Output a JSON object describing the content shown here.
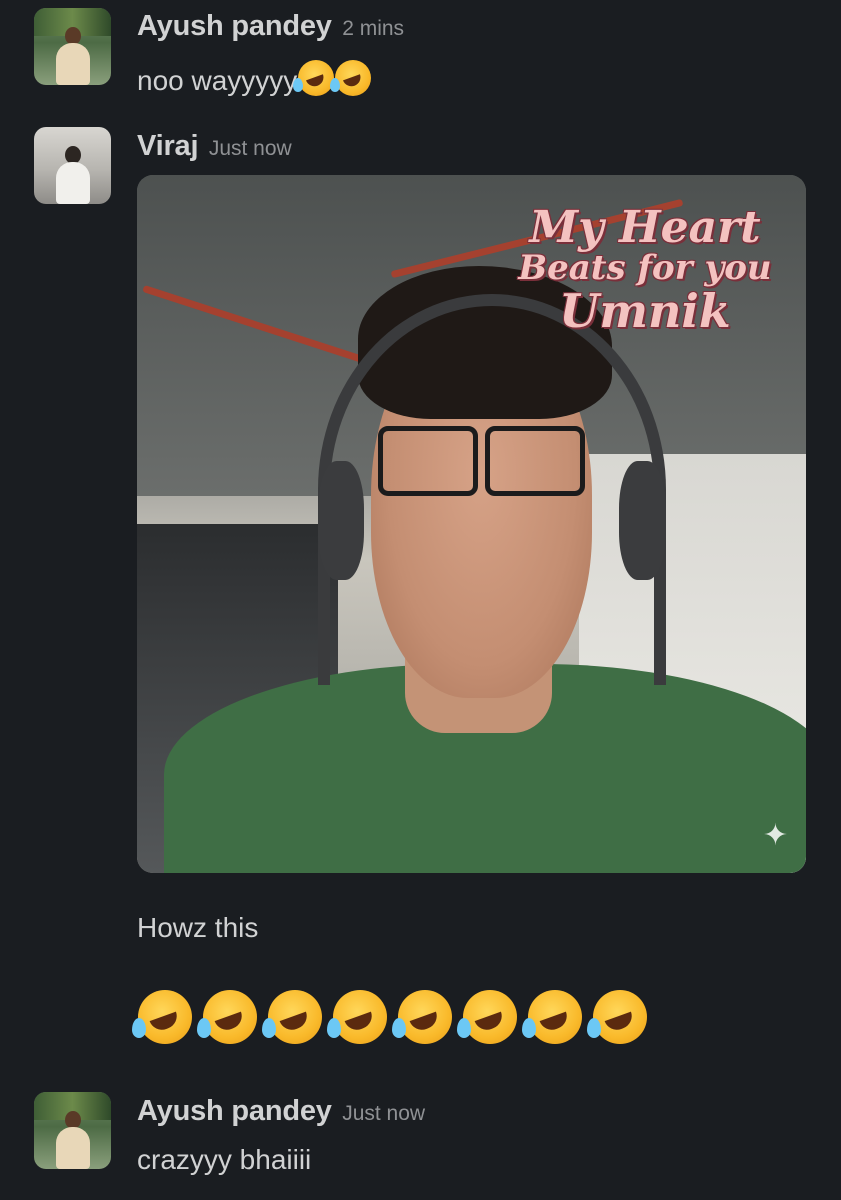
{
  "messages": [
    {
      "author": "Ayush pandey",
      "time": "2 mins",
      "text": "noo wayyyyy",
      "emoji": [
        "rolling-on-floor-laughing",
        "rolling-on-floor-laughing"
      ]
    },
    {
      "author": "Viraj",
      "time": "Just now",
      "image": {
        "sticker_line1": "My Heart",
        "sticker_line2": "Beats for you",
        "sticker_line3": "Umnik"
      },
      "text": "Howz this",
      "big_emoji": [
        "rolling-on-floor-laughing",
        "rolling-on-floor-laughing",
        "rolling-on-floor-laughing",
        "rolling-on-floor-laughing",
        "rolling-on-floor-laughing",
        "rolling-on-floor-laughing",
        "rolling-on-floor-laughing",
        "rolling-on-floor-laughing"
      ]
    },
    {
      "author": "Ayush pandey",
      "time": "Just now",
      "text": "crazyyy bhaiiii"
    }
  ],
  "colors": {
    "background": "#1a1d21",
    "text": "#d1d2d3",
    "timestamp": "#8f9194"
  }
}
